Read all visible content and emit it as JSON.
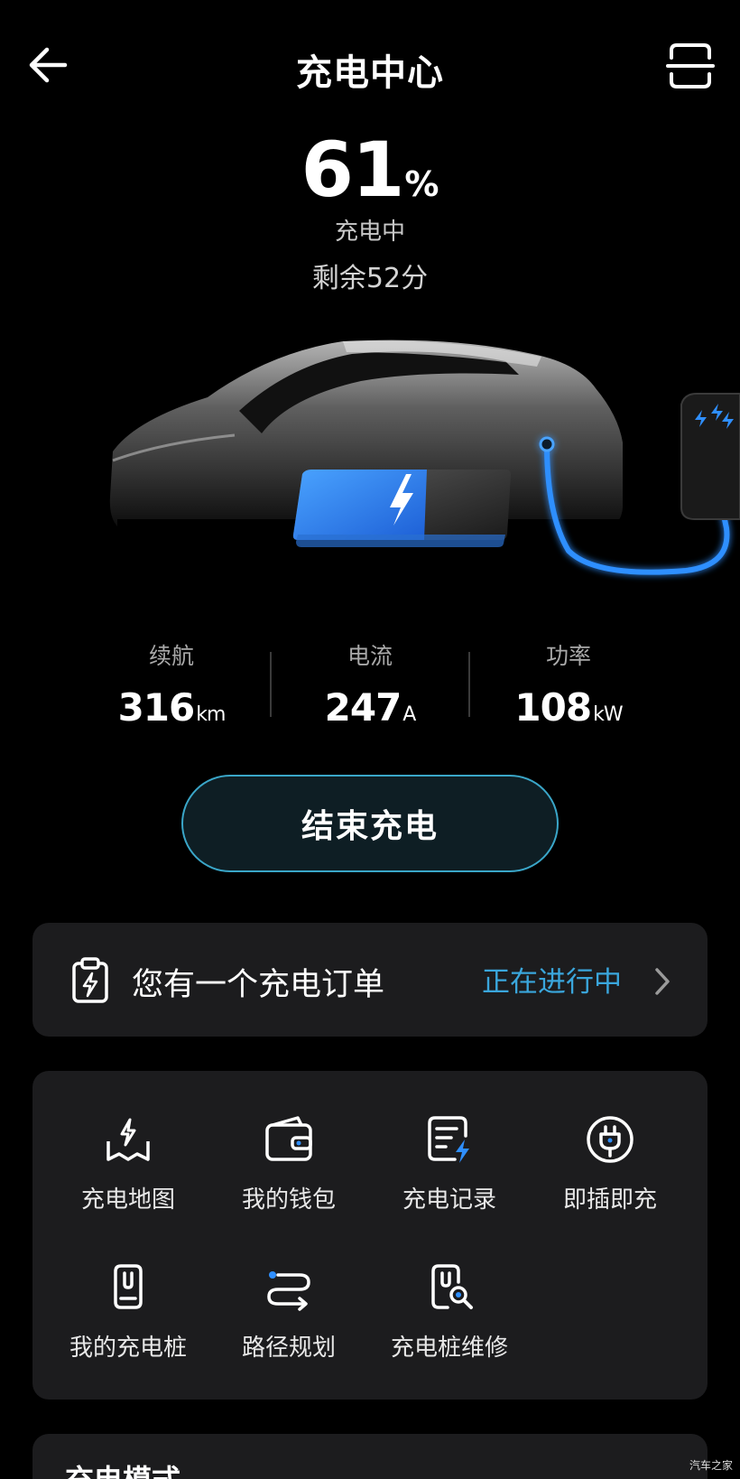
{
  "header": {
    "title": "充电中心",
    "back_icon": "arrow-left-icon",
    "scan_icon": "scan-icon"
  },
  "battery": {
    "soc_value": "61",
    "soc_unit": "%",
    "soc_level": 0.61,
    "status": "充电中",
    "remaining": "剩余52分"
  },
  "stats": [
    {
      "label": "续航",
      "value": "316",
      "unit": "km"
    },
    {
      "label": "电流",
      "value": "247",
      "unit": "A"
    },
    {
      "label": "功率",
      "value": "108",
      "unit": "kW"
    }
  ],
  "end_button": {
    "label": "结束充电"
  },
  "order": {
    "icon": "clipboard-bolt-icon",
    "text": "您有一个充电订单",
    "status": "正在进行中",
    "chevron_icon": "chevron-right-icon"
  },
  "grid": {
    "items": [
      {
        "label": "充电地图",
        "icon": "charge-map-icon"
      },
      {
        "label": "我的钱包",
        "icon": "wallet-icon"
      },
      {
        "label": "充电记录",
        "icon": "charge-record-icon"
      },
      {
        "label": "即插即充",
        "icon": "plug-icon"
      },
      {
        "label": "我的充电桩",
        "icon": "charger-pile-icon"
      },
      {
        "label": "路径规划",
        "icon": "route-icon"
      },
      {
        "label": "充电桩维修",
        "icon": "repair-icon"
      }
    ]
  },
  "bottom_section": {
    "title": "充电模式"
  },
  "watermark": "汽车之家",
  "colors": {
    "accent_blue": "#3aa6dc",
    "button_border": "#3aa6c8",
    "card_bg": "#1c1c1e",
    "cable_blue": "#2f8fff"
  }
}
